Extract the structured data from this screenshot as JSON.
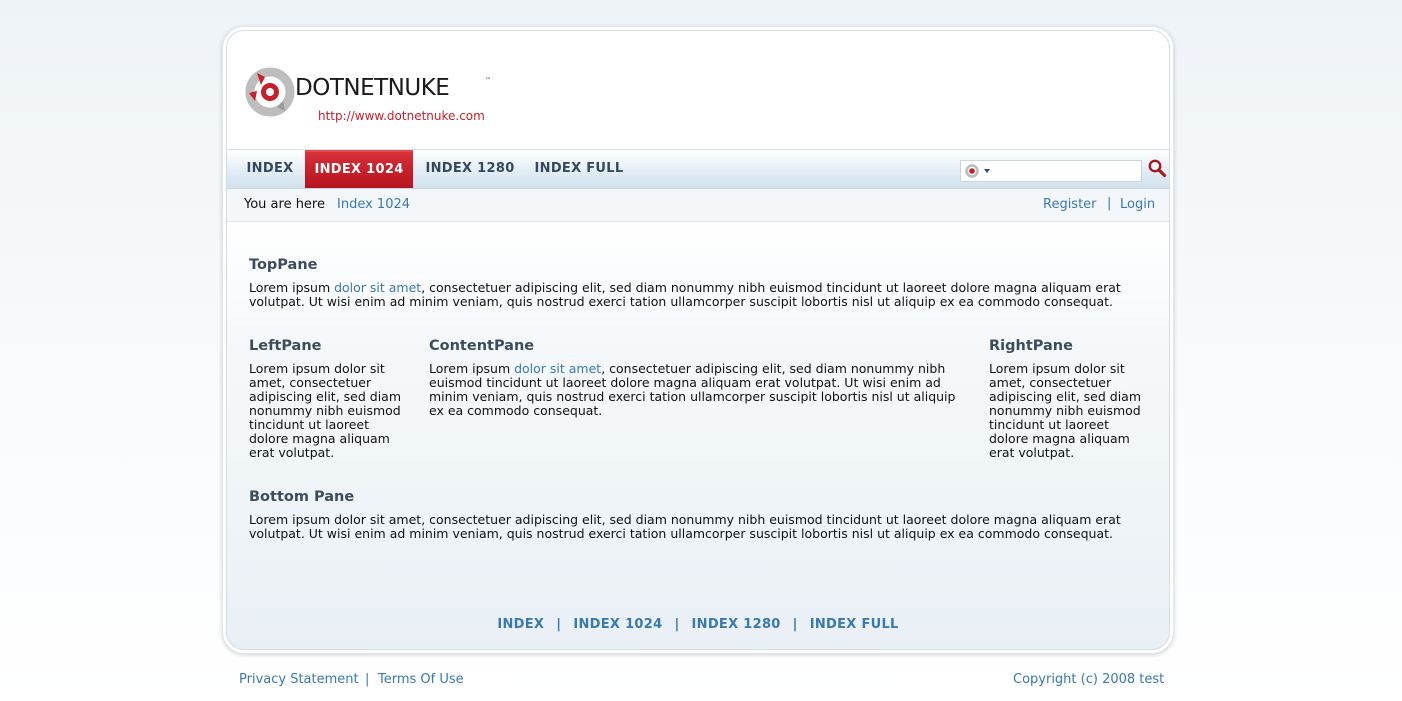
{
  "logo": {
    "name": "DOTNETNUKE",
    "tm": "™",
    "url": "http://www.dotnetnuke.com"
  },
  "nav": {
    "items": [
      {
        "label": "INDEX"
      },
      {
        "label": "INDEX 1024",
        "active": true
      },
      {
        "label": "INDEX 1280"
      },
      {
        "label": "INDEX FULL"
      }
    ]
  },
  "search": {
    "value": "",
    "provider_icon": "dnn-logo-icon",
    "go_icon": "magnifier-icon"
  },
  "breadcrumb": {
    "label": "You are here",
    "current": "Index 1024"
  },
  "user_links": {
    "register": "Register",
    "separator": "|",
    "login": "Login"
  },
  "panes": {
    "top": {
      "title": "TopPane",
      "text_before_link": "Lorem ipsum ",
      "link": "dolor sit amet",
      "text_after_link": ", consectetuer adipiscing elit, sed diam nonummy nibh euismod tincidunt ut laoreet dolore magna aliquam erat volutpat. Ut wisi enim ad minim veniam, quis nostrud exerci tation ullamcorper suscipit lobortis nisl ut aliquip ex ea commodo consequat."
    },
    "left": {
      "title": "LeftPane",
      "text": "Lorem ipsum dolor sit amet, consectetuer adipiscing elit, sed diam nonummy nibh euismod tincidunt ut laoreet dolore magna aliquam erat volutpat."
    },
    "content": {
      "title": "ContentPane",
      "text_before_link": "Lorem ipsum ",
      "link": "dolor sit amet",
      "text_after_link": ", consectetuer adipiscing elit, sed diam nonummy nibh euismod tincidunt ut laoreet dolore magna aliquam erat volutpat. Ut wisi enim ad minim veniam, quis nostrud exerci tation ullamcorper suscipit lobortis nisl ut aliquip ex ea commodo consequat."
    },
    "right": {
      "title": "RightPane",
      "text": "Lorem ipsum dolor sit amet, consectetuer adipiscing elit, sed diam nonummy nibh euismod tincidunt ut laoreet dolore magna aliquam erat volutpat."
    },
    "bottom": {
      "title": "Bottom Pane",
      "text": "Lorem ipsum dolor sit amet, consectetuer adipiscing elit, sed diam nonummy nibh euismod tincidunt ut laoreet dolore magna aliquam erat volutpat. Ut wisi enim ad minim veniam, quis nostrud exerci tation ullamcorper suscipit lobortis nisl ut aliquip ex ea commodo consequat."
    }
  },
  "footer_nav": {
    "items": [
      "INDEX",
      "INDEX 1024",
      "INDEX 1280",
      "INDEX FULL"
    ],
    "separator": "|"
  },
  "page_footer": {
    "privacy": "Privacy Statement",
    "separator": "|",
    "terms": "Terms Of Use",
    "copyright": "Copyright (c) 2008 test"
  },
  "colors": {
    "accent_red": "#c8202a",
    "link_blue": "#3a78b0",
    "heading": "#3b4c5d"
  }
}
